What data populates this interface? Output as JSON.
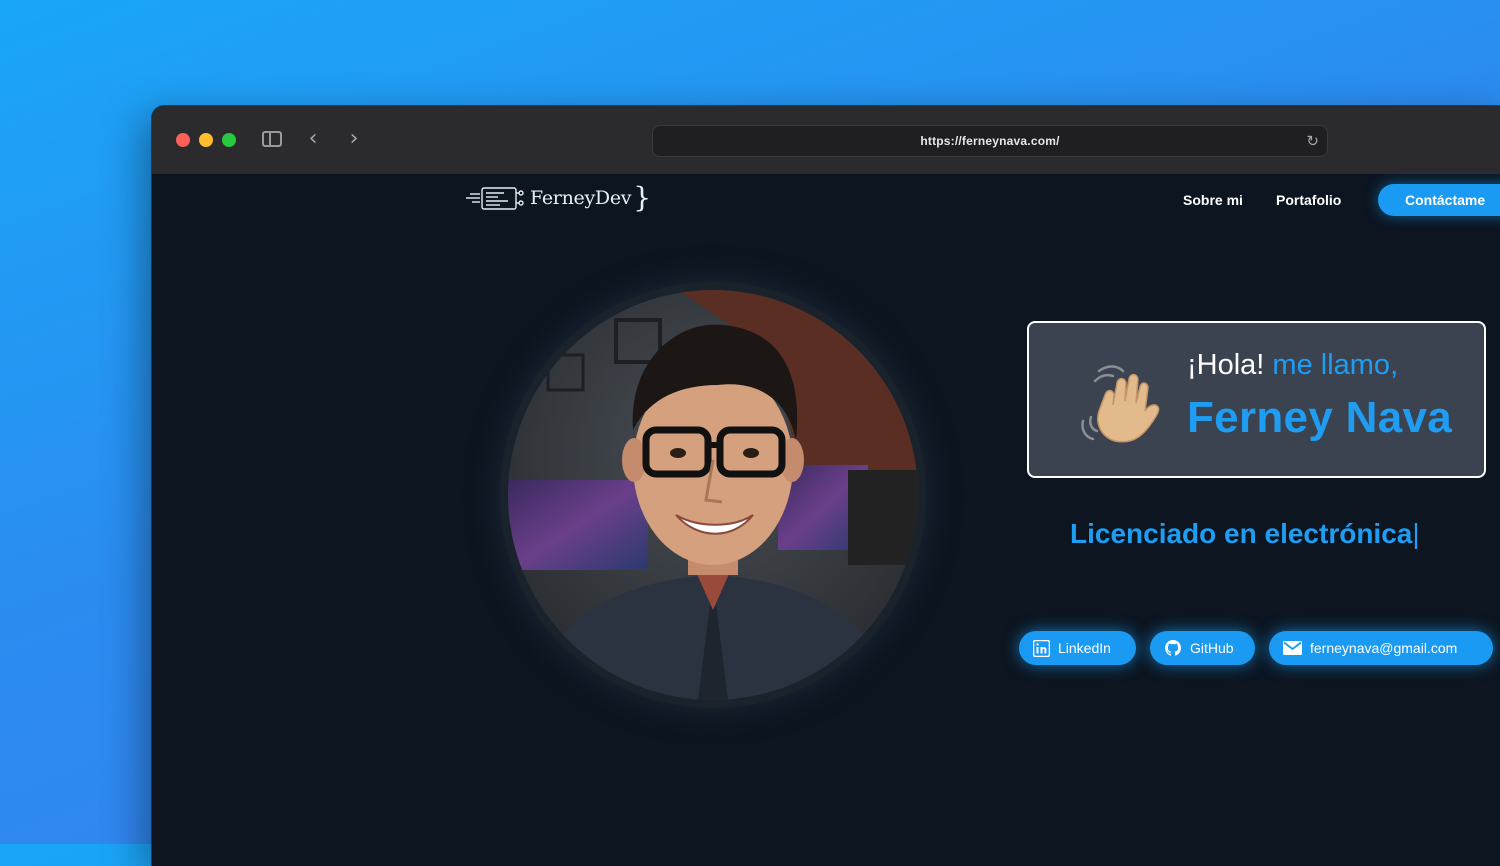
{
  "browser": {
    "url": "https://ferneynava.com/",
    "controls": [
      "close-dot",
      "minimize-dot",
      "maximize-dot",
      "sidebar-toggle-icon",
      "back-icon",
      "forward-icon",
      "reload-icon"
    ]
  },
  "header": {
    "logo_text": "FerneyDev",
    "logo_brace": "}",
    "nav": {
      "about": "Sobre mi",
      "portfolio": "Portafolio",
      "contact": "Contáctame"
    }
  },
  "hero": {
    "hello_prefix": "¡Hola!",
    "hello_suffix": "me llamo,",
    "name": "Ferney Nava",
    "profession": "Licenciado en electrónica",
    "caret": "|"
  },
  "social": {
    "linkedin": "LinkedIn",
    "github": "GitHub",
    "email": "ferneynava@gmail.com"
  },
  "colors": {
    "accent": "#1e9df3",
    "page_bg": "#0c1520",
    "card_bg": "#3b4350"
  }
}
